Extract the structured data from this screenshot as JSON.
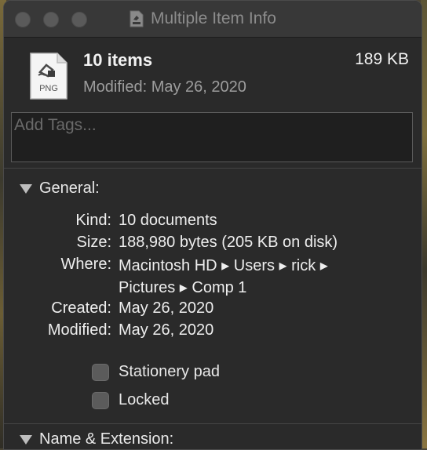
{
  "window": {
    "title": "Multiple Item Info",
    "title_icon": "png-file-icon"
  },
  "summary": {
    "count": "10 items",
    "size": "189 KB",
    "modified": "Modified: May 26, 2020",
    "file_type_badge": "PNG"
  },
  "tags": {
    "placeholder": "Add Tags..."
  },
  "general": {
    "header": "General:",
    "rows": [
      {
        "label": "Kind:",
        "value": "10 documents"
      },
      {
        "label": "Size:",
        "value": "188,980 bytes (205 KB on disk)"
      },
      {
        "label": "Where:",
        "value": "Macintosh HD ▸ Users ▸ rick ▸"
      },
      {
        "label": "",
        "value": "Pictures ▸ Comp 1"
      },
      {
        "label": "Created:",
        "value": "May 26, 2020"
      },
      {
        "label": "Modified:",
        "value": "May 26, 2020"
      }
    ],
    "checkboxes": [
      {
        "label": "Stationery pad",
        "checked": false
      },
      {
        "label": "Locked",
        "checked": false
      }
    ]
  },
  "name_extension": {
    "header": "Name & Extension:"
  }
}
